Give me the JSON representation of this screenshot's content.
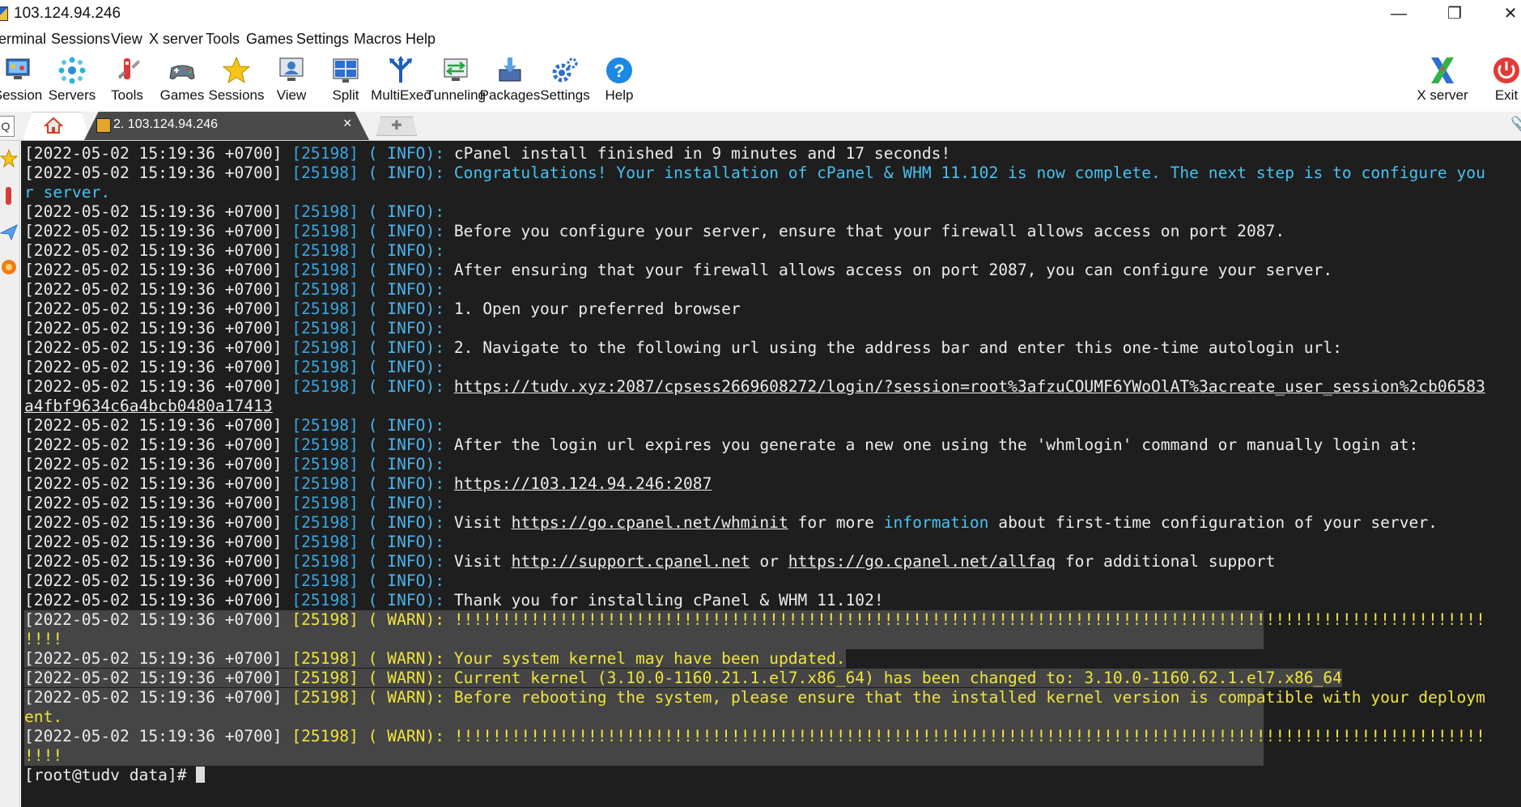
{
  "window": {
    "title": "103.124.94.246",
    "min_glyph": "—",
    "max_glyph": "❐",
    "close_glyph": "✕"
  },
  "menu": [
    "erminal",
    "Sessions",
    "View",
    "X server",
    "Tools",
    "Games",
    "Settings",
    "Macros",
    "Help"
  ],
  "toolbar": {
    "left": [
      {
        "label": "Session",
        "icon": "session-icon"
      },
      {
        "label": "Servers",
        "icon": "servers-icon"
      },
      {
        "label": "Tools",
        "icon": "tools-icon"
      },
      {
        "label": "Games",
        "icon": "games-icon"
      },
      {
        "label": "Sessions",
        "icon": "sessions-star-icon"
      },
      {
        "label": "View",
        "icon": "view-icon"
      },
      {
        "label": "Split",
        "icon": "split-icon"
      },
      {
        "label": "MultiExec",
        "icon": "multiexec-icon"
      },
      {
        "label": "Tunneling",
        "icon": "tunneling-icon"
      },
      {
        "label": "Packages",
        "icon": "packages-icon"
      },
      {
        "label": "Settings",
        "icon": "settings-icon"
      },
      {
        "label": "Help",
        "icon": "help-icon"
      }
    ],
    "right": [
      {
        "label": "X server",
        "icon": "xserver-icon"
      },
      {
        "label": "Exit",
        "icon": "exit-icon"
      }
    ]
  },
  "tabs": {
    "active_label": "2. 103.124.94.246",
    "close_glyph": "×",
    "new_tab_glyph": "✚",
    "search_glyph": "Q"
  },
  "colors": {
    "terminal_bg": "#1e1e1e",
    "pid": "#36a8e0",
    "warn": "#f0e43c",
    "highlight": "#48c1f0"
  },
  "terminal": {
    "lines": [
      {
        "ts": "[2022-05-02 15:19:36 +0700] ",
        "pid": "[25198]",
        "lvl": " ( INFO):",
        "msg": " cPanel install finished in 9 minutes and 17 seconds!"
      },
      {
        "ts": "[2022-05-02 15:19:36 +0700] ",
        "pid": "[25198]",
        "lvl": " ( INFO):",
        "hl": " Congratulations! Your installation of cPanel & WHM 11.102 is now complete. The next step is to configure you"
      },
      {
        "hl_cont": "r server."
      },
      {
        "ts": "[2022-05-02 15:19:36 +0700] ",
        "pid": "[25198]",
        "lvl": " ( INFO):"
      },
      {
        "ts": "[2022-05-02 15:19:36 +0700] ",
        "pid": "[25198]",
        "lvl": " ( INFO):",
        "msg": " Before you configure your server, ensure that your firewall allows access on port 2087."
      },
      {
        "ts": "[2022-05-02 15:19:36 +0700] ",
        "pid": "[25198]",
        "lvl": " ( INFO):"
      },
      {
        "ts": "[2022-05-02 15:19:36 +0700] ",
        "pid": "[25198]",
        "lvl": " ( INFO):",
        "msg": " After ensuring that your firewall allows access on port 2087, you can configure your server."
      },
      {
        "ts": "[2022-05-02 15:19:36 +0700] ",
        "pid": "[25198]",
        "lvl": " ( INFO):"
      },
      {
        "ts": "[2022-05-02 15:19:36 +0700] ",
        "pid": "[25198]",
        "lvl": " ( INFO):",
        "msg": " 1. Open your preferred browser"
      },
      {
        "ts": "[2022-05-02 15:19:36 +0700] ",
        "pid": "[25198]",
        "lvl": " ( INFO):"
      },
      {
        "ts": "[2022-05-02 15:19:36 +0700] ",
        "pid": "[25198]",
        "lvl": " ( INFO):",
        "msg": " 2. Navigate to the following url using the address bar and enter this one-time autologin url:"
      },
      {
        "ts": "[2022-05-02 15:19:36 +0700] ",
        "pid": "[25198]",
        "lvl": " ( INFO):"
      },
      {
        "ts": "[2022-05-02 15:19:36 +0700] ",
        "pid": "[25198]",
        "lvl": " ( INFO):",
        "msg": " ",
        "url": "https://tudv.xyz:2087/cpsess2669608272/login/?session=root%3afzuCOUMF6YWoOlAT%3acreate_user_session%2cb06583"
      },
      {
        "url_cont": "a4fbf9634c6a4bcb0480a17413"
      },
      {
        "ts": "[2022-05-02 15:19:36 +0700] ",
        "pid": "[25198]",
        "lvl": " ( INFO):"
      },
      {
        "ts": "[2022-05-02 15:19:36 +0700] ",
        "pid": "[25198]",
        "lvl": " ( INFO):",
        "msg": " After the login url expires you generate a new one using the 'whmlogin' command or manually login at:"
      },
      {
        "ts": "[2022-05-02 15:19:36 +0700] ",
        "pid": "[25198]",
        "lvl": " ( INFO):"
      },
      {
        "ts": "[2022-05-02 15:19:36 +0700] ",
        "pid": "[25198]",
        "lvl": " ( INFO):",
        "msg": " ",
        "url": "https://103.124.94.246:2087"
      },
      {
        "ts": "[2022-05-02 15:19:36 +0700] ",
        "pid": "[25198]",
        "lvl": " ( INFO):"
      },
      {
        "ts": "[2022-05-02 15:19:36 +0700] ",
        "pid": "[25198]",
        "lvl": " ( INFO):",
        "msg": " Visit ",
        "url": "https://go.cpanel.net/whminit",
        "msg2": " for more ",
        "hl2": "information",
        "msg3": " about first-time configuration of your server."
      },
      {
        "ts": "[2022-05-02 15:19:36 +0700] ",
        "pid": "[25198]",
        "lvl": " ( INFO):"
      },
      {
        "ts": "[2022-05-02 15:19:36 +0700] ",
        "pid": "[25198]",
        "lvl": " ( INFO):",
        "msg": " Visit ",
        "url": "http://support.cpanel.net",
        "msg2": " or ",
        "url2": "https://go.cpanel.net/allfaq",
        "msg3": " for additional support"
      },
      {
        "ts": "[2022-05-02 15:19:36 +0700] ",
        "pid": "[25198]",
        "lvl": " ( INFO):"
      },
      {
        "ts": "[2022-05-02 15:19:36 +0700] ",
        "pid": "[25198]",
        "lvl": " ( INFO):",
        "msg": " Thank you for installing cPanel & WHM 11.102!"
      },
      {
        "warn": true,
        "full": true,
        "ts": "[2022-05-02 15:19:36 +0700] ",
        "pid": "[25198]",
        "lvl": " ( WARN):",
        "msg": " !!!!!!!!!!!!!!!!!!!!!!!!!!!!!!!!!!!!!!!!!!!!!!!!!!!!!!!!!!!!!!!!!!!!!!!!!!!!!!!!!!!!!!!!!!!!!!!!!!!!!!!!!!!!"
      },
      {
        "warn": true,
        "full": true,
        "cont": "!!!!"
      },
      {
        "warn": true,
        "ts": "[2022-05-02 15:19:36 +0700] ",
        "pid": "[25198]",
        "lvl": " ( WARN):",
        "msg": " Your system kernel may have been updated."
      },
      {
        "warn": true,
        "ts": "[2022-05-02 15:19:36 +0700] ",
        "pid": "[25198]",
        "lvl": " ( WARN):",
        "msg": " Current kernel (3.10.0-1160.21.1.el7.x86_64) has been changed to: 3.10.0-1160.62.1.el7.x86_64"
      },
      {
        "warn": true,
        "full": true,
        "ts": "[2022-05-02 15:19:36 +0700] ",
        "pid": "[25198]",
        "lvl": " ( WARN):",
        "msg": " Before rebooting the system, please ensure that the installed kernel version is compatible with your deploym"
      },
      {
        "warn": true,
        "full": true,
        "cont": "ent."
      },
      {
        "warn": true,
        "full": true,
        "ts": "[2022-05-02 15:19:36 +0700] ",
        "pid": "[25198]",
        "lvl": " ( WARN):",
        "msg": " !!!!!!!!!!!!!!!!!!!!!!!!!!!!!!!!!!!!!!!!!!!!!!!!!!!!!!!!!!!!!!!!!!!!!!!!!!!!!!!!!!!!!!!!!!!!!!!!!!!!!!!!!!!!"
      },
      {
        "warn": true,
        "full": true,
        "cont": "!!!!"
      },
      {
        "prompt": "[root@tudv data]# "
      }
    ]
  }
}
